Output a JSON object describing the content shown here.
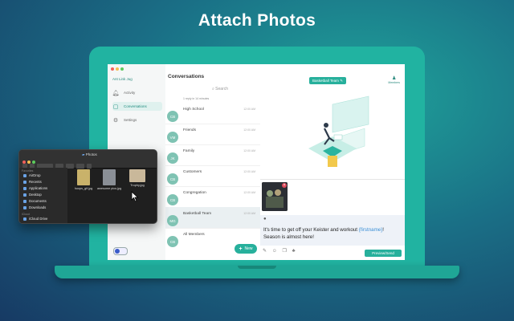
{
  "headline": "Attach Photos",
  "nav": {
    "brand": "Ant Link Jug",
    "items": [
      {
        "label": "Activity",
        "icon": "bell-icon"
      },
      {
        "label": "Conversations",
        "icon": "chat-bubbles-icon"
      },
      {
        "label": "Settings",
        "icon": "gear-icon"
      }
    ]
  },
  "conversations": {
    "title": "Conversations",
    "search_placeholder": "Search",
    "subtitle": "1 reply in 14 minutes",
    "items": [
      {
        "name": "High School",
        "initials": "CB",
        "time": "12:00 AM"
      },
      {
        "name": "Friends",
        "initials": "VM",
        "time": "12:00 AM"
      },
      {
        "name": "Family",
        "initials": "JK",
        "time": "12:00 AM"
      },
      {
        "name": "Customers",
        "initials": "CB",
        "time": "12:00 AM"
      },
      {
        "name": "Congregation",
        "initials": "CB",
        "time": "12:00 AM"
      },
      {
        "name": "Basketball Team",
        "initials": "MG",
        "time": "12:00 AM"
      },
      {
        "name": "All Members",
        "initials": "CB",
        "time": "12:00 AM"
      }
    ],
    "new_label": "New"
  },
  "chat": {
    "team_tag": "Basketball Team",
    "members_label": "Members",
    "message_part1": "It's time to get off your Keister and workout ",
    "message_var": "{firstname}",
    "message_part2": "! Season is almost here!",
    "send_label": "Preview/Send"
  },
  "finder": {
    "title": "Photos",
    "favorites_label": "Favorites",
    "sidebar": [
      "AirDrop",
      "Recents",
      "Applications",
      "Desktop",
      "Documents",
      "Downloads"
    ],
    "icloud_label": "iCloud",
    "icloud_item": "iCloud Drive",
    "files": [
      {
        "name": "hoops_gif.jpg",
        "color": "#c9b26a"
      },
      {
        "name": "awesome pics.jpg",
        "color": "#8a8f96"
      },
      {
        "name": "Trophy.jpg",
        "color": "#c9b89a"
      }
    ]
  },
  "colors": {
    "accent": "#27b09c",
    "laptop": "#21b3a1"
  }
}
